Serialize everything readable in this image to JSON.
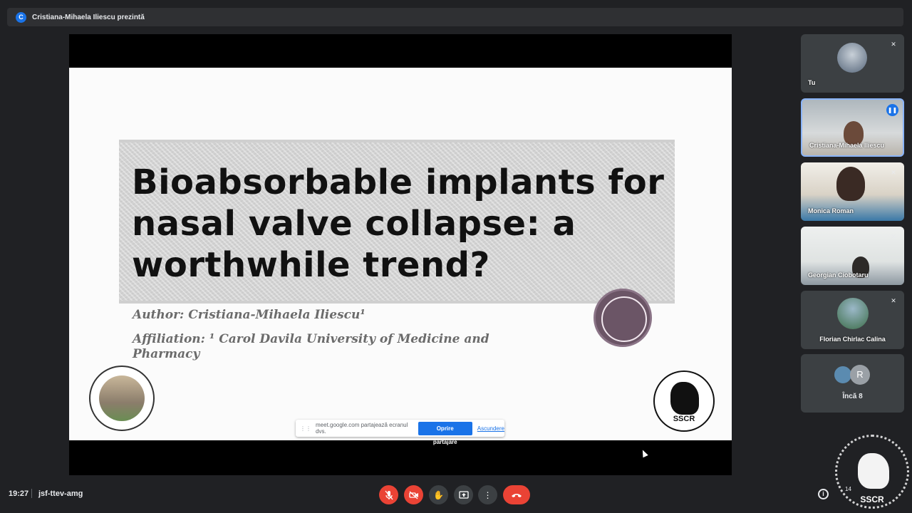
{
  "topbar": {
    "avatar_letter": "C",
    "presenter_text": "Cristiana-Mihaela Iliescu prezintă"
  },
  "slide": {
    "title": "Bioabsorbable implants for nasal valve collapse: a worthwhile trend?",
    "author": "Author: Cristiana-Mihaela Iliescu¹",
    "affiliation": "Affiliation: ¹ Carol Davila University of Medicine and Pharmacy",
    "logo_right_text": "SSCR"
  },
  "share_bar": {
    "message": "meet.google.com partajează ecranul dvs.",
    "stop_label": "Oprire partajare",
    "hide_label": "Ascundere"
  },
  "participants": [
    {
      "name": "Tu",
      "muted": true
    },
    {
      "name": "Cristiana-Mihaela Iliescu",
      "speaking": true
    },
    {
      "name": "Monica Roman",
      "muted": true
    },
    {
      "name": "Georgian Ciobotaru",
      "muted": true
    },
    {
      "name": "Florian Chirlac Calina",
      "muted": true
    }
  ],
  "more": {
    "letter": "R",
    "label": "Încă 8"
  },
  "bottom": {
    "time": "19:27",
    "meeting_code": "jsf-ttev-amg",
    "people_count": "14"
  },
  "watermark": {
    "text": "SSCR"
  },
  "icons": {
    "mic": "mic-off-icon",
    "camera": "camera-off-icon",
    "hand": "raise-hand-icon",
    "present": "present-screen-icon",
    "more": "more-options-icon",
    "end": "end-call-icon",
    "info": "info-icon"
  },
  "colors": {
    "accent": "#1a73e8",
    "danger": "#ea4335",
    "background": "#202124"
  }
}
